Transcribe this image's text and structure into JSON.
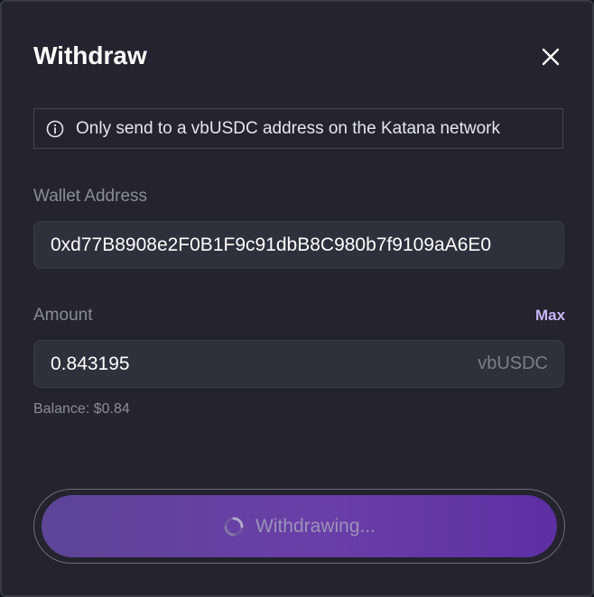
{
  "dialog": {
    "title": "Withdraw"
  },
  "notice": {
    "text": "Only send to a vbUSDC address on the Katana network"
  },
  "wallet": {
    "label": "Wallet Address",
    "value": "0xd77B8908e2F0B1F9c91dbB8C980b7f9109aA6E0"
  },
  "amount": {
    "label": "Amount",
    "max_label": "Max",
    "value": "0.843195",
    "unit": "vbUSDC"
  },
  "balance": {
    "text": "Balance: $0.84"
  },
  "submit": {
    "label": "Withdrawing...",
    "state": "loading"
  },
  "colors": {
    "background": "#24232e",
    "accent": "#c4b5f5",
    "button_gradient_start": "#5d4597",
    "button_gradient_end": "#5d2fa3"
  },
  "icons": {
    "close": "close-icon",
    "info": "info-icon",
    "spinner": "loading-spinner-icon"
  }
}
